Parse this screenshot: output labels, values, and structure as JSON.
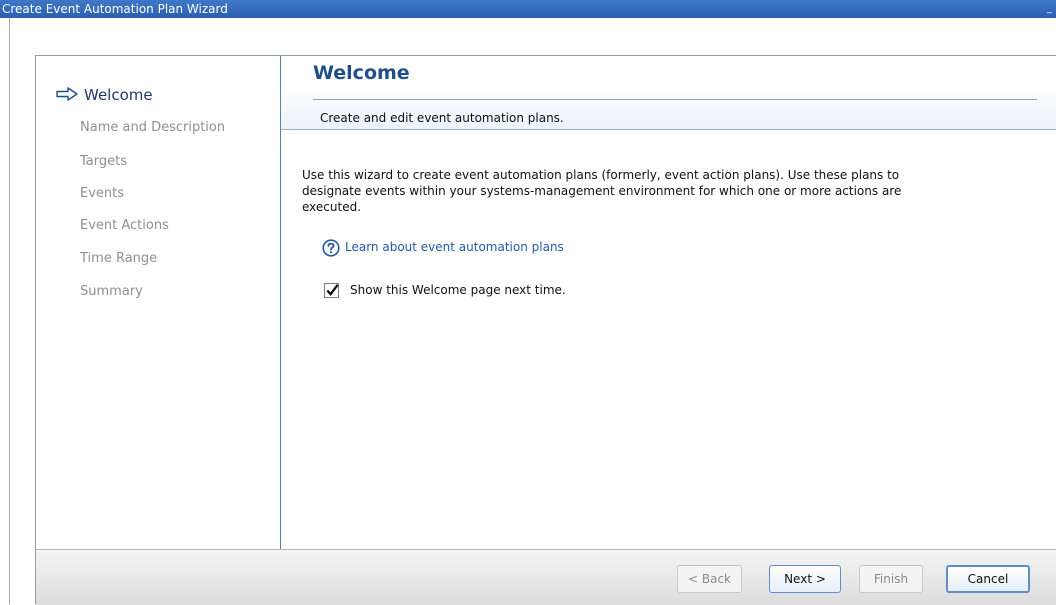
{
  "window": {
    "title": "Create Event Automation Plan Wizard",
    "minimize_glyph": "_"
  },
  "nav": {
    "current_icon": "right-arrow-icon",
    "items": [
      {
        "label": "Welcome",
        "state": "current"
      },
      {
        "label": "Name and Description",
        "state": "disabled"
      },
      {
        "label": "Targets",
        "state": "disabled"
      },
      {
        "label": "Events",
        "state": "disabled"
      },
      {
        "label": "Event Actions",
        "state": "disabled"
      },
      {
        "label": "Time Range",
        "state": "disabled"
      },
      {
        "label": "Summary",
        "state": "disabled"
      }
    ]
  },
  "page": {
    "title": "Welcome",
    "subtitle": "Create and edit event automation plans.",
    "description_line1": "Use this wizard to create event automation plans (formerly, event action plans). Use these plans to",
    "description_line2": "designate events within your systems-management environment for which one or more actions are",
    "description_line3": "executed.",
    "learn_link": "Learn about event automation plans",
    "learn_icon": "help-icon",
    "show_welcome": {
      "label": "Show this Welcome page next time.",
      "checked": true
    }
  },
  "buttons": {
    "back": "< Back",
    "next": "Next >",
    "finish": "Finish",
    "cancel": "Cancel"
  },
  "colors": {
    "titlebar": "#2a5fb0",
    "heading": "#1f4f8a",
    "link": "#2459a8",
    "button_border": "#5f8fc6"
  }
}
